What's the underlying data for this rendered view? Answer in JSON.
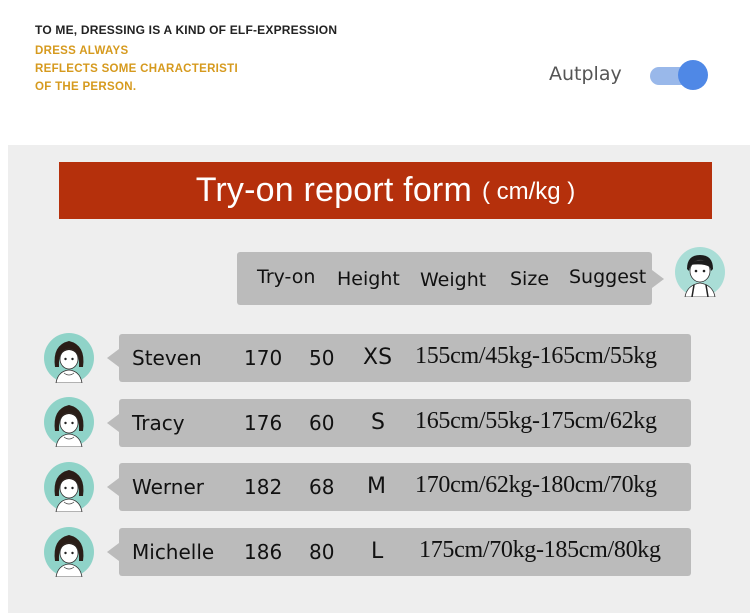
{
  "tagline": {
    "main": "TO ME, DRESSING IS A KIND OF   ELF-EXPRESSION",
    "sub": [
      "DRESS ALWAYS",
      "REFLECTS SOME CHARACTERISTI",
      "OF THE PERSON."
    ]
  },
  "autoplay": {
    "label": "Autplay",
    "on": true
  },
  "colors": {
    "banner": "#b5300c",
    "tagline_sub": "#d69a1e",
    "toggle_knob": "#4f88e6",
    "toggle_track": "#99b8ea",
    "cell_bg": "#bbbbbb",
    "avatar_bg": "#8fd3c8"
  },
  "form": {
    "title": "Try-on report form",
    "unit": "( cm/kg )",
    "headers": [
      "Try-on",
      "Height",
      "Weight",
      "Size",
      "Suggest"
    ],
    "rows": [
      {
        "name": "Steven",
        "height": "170",
        "weight": "50",
        "size": "XS",
        "suggest": "155cm/45kg-165cm/55kg"
      },
      {
        "name": "Tracy",
        "height": "176",
        "weight": "60",
        "size": "S",
        "suggest": "165cm/55kg-175cm/62kg"
      },
      {
        "name": "Werner",
        "height": "182",
        "weight": "68",
        "size": "M",
        "suggest": "170cm/62kg-180cm/70kg"
      },
      {
        "name": "Michelle",
        "height": "186",
        "weight": "80",
        "size": "L",
        "suggest": "175cm/70kg-185cm/80kg"
      }
    ]
  },
  "icons": {
    "female_avatar": "girl-avatar-icon",
    "male_avatar": "boy-avatar-icon"
  }
}
